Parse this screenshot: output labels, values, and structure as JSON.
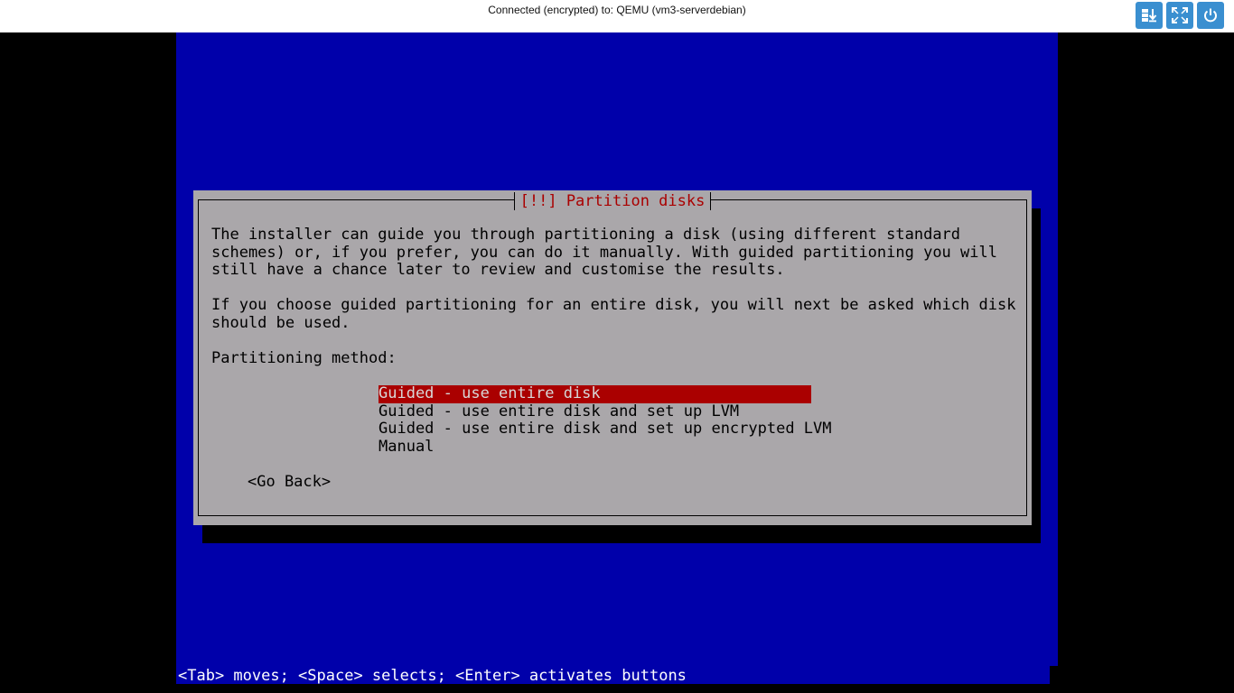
{
  "topbar": {
    "title": "Connected (encrypted) to: QEMU (vm3-serverdebian)",
    "buttons": [
      {
        "icon": "download-icon"
      },
      {
        "icon": "fullscreen-icon"
      },
      {
        "icon": "power-icon"
      }
    ],
    "accent_color": "#3a8fd0"
  },
  "screen": {
    "background_color": "#0000aa"
  },
  "dialog": {
    "title": "[!!] Partition disks",
    "title_color": "#aa0000",
    "background_color": "#aaa7aa",
    "paragraph1": "The installer can guide you through partitioning a disk (using different standard\nschemes) or, if you prefer, you can do it manually. With guided partitioning you will\nstill have a chance later to review and customise the results.",
    "paragraph2": "If you choose guided partitioning for an entire disk, you will next be asked which disk\nshould be used.",
    "method_label": "Partitioning method:",
    "options": [
      {
        "label": "Guided - use entire disk",
        "selected": true
      },
      {
        "label": "Guided - use entire disk and set up LVM",
        "selected": false
      },
      {
        "label": "Guided - use entire disk and set up encrypted LVM",
        "selected": false
      },
      {
        "label": "Manual",
        "selected": false
      }
    ],
    "go_back": "<Go Back>"
  },
  "hint": "<Tab> moves; <Space> selects; <Enter> activates buttons"
}
